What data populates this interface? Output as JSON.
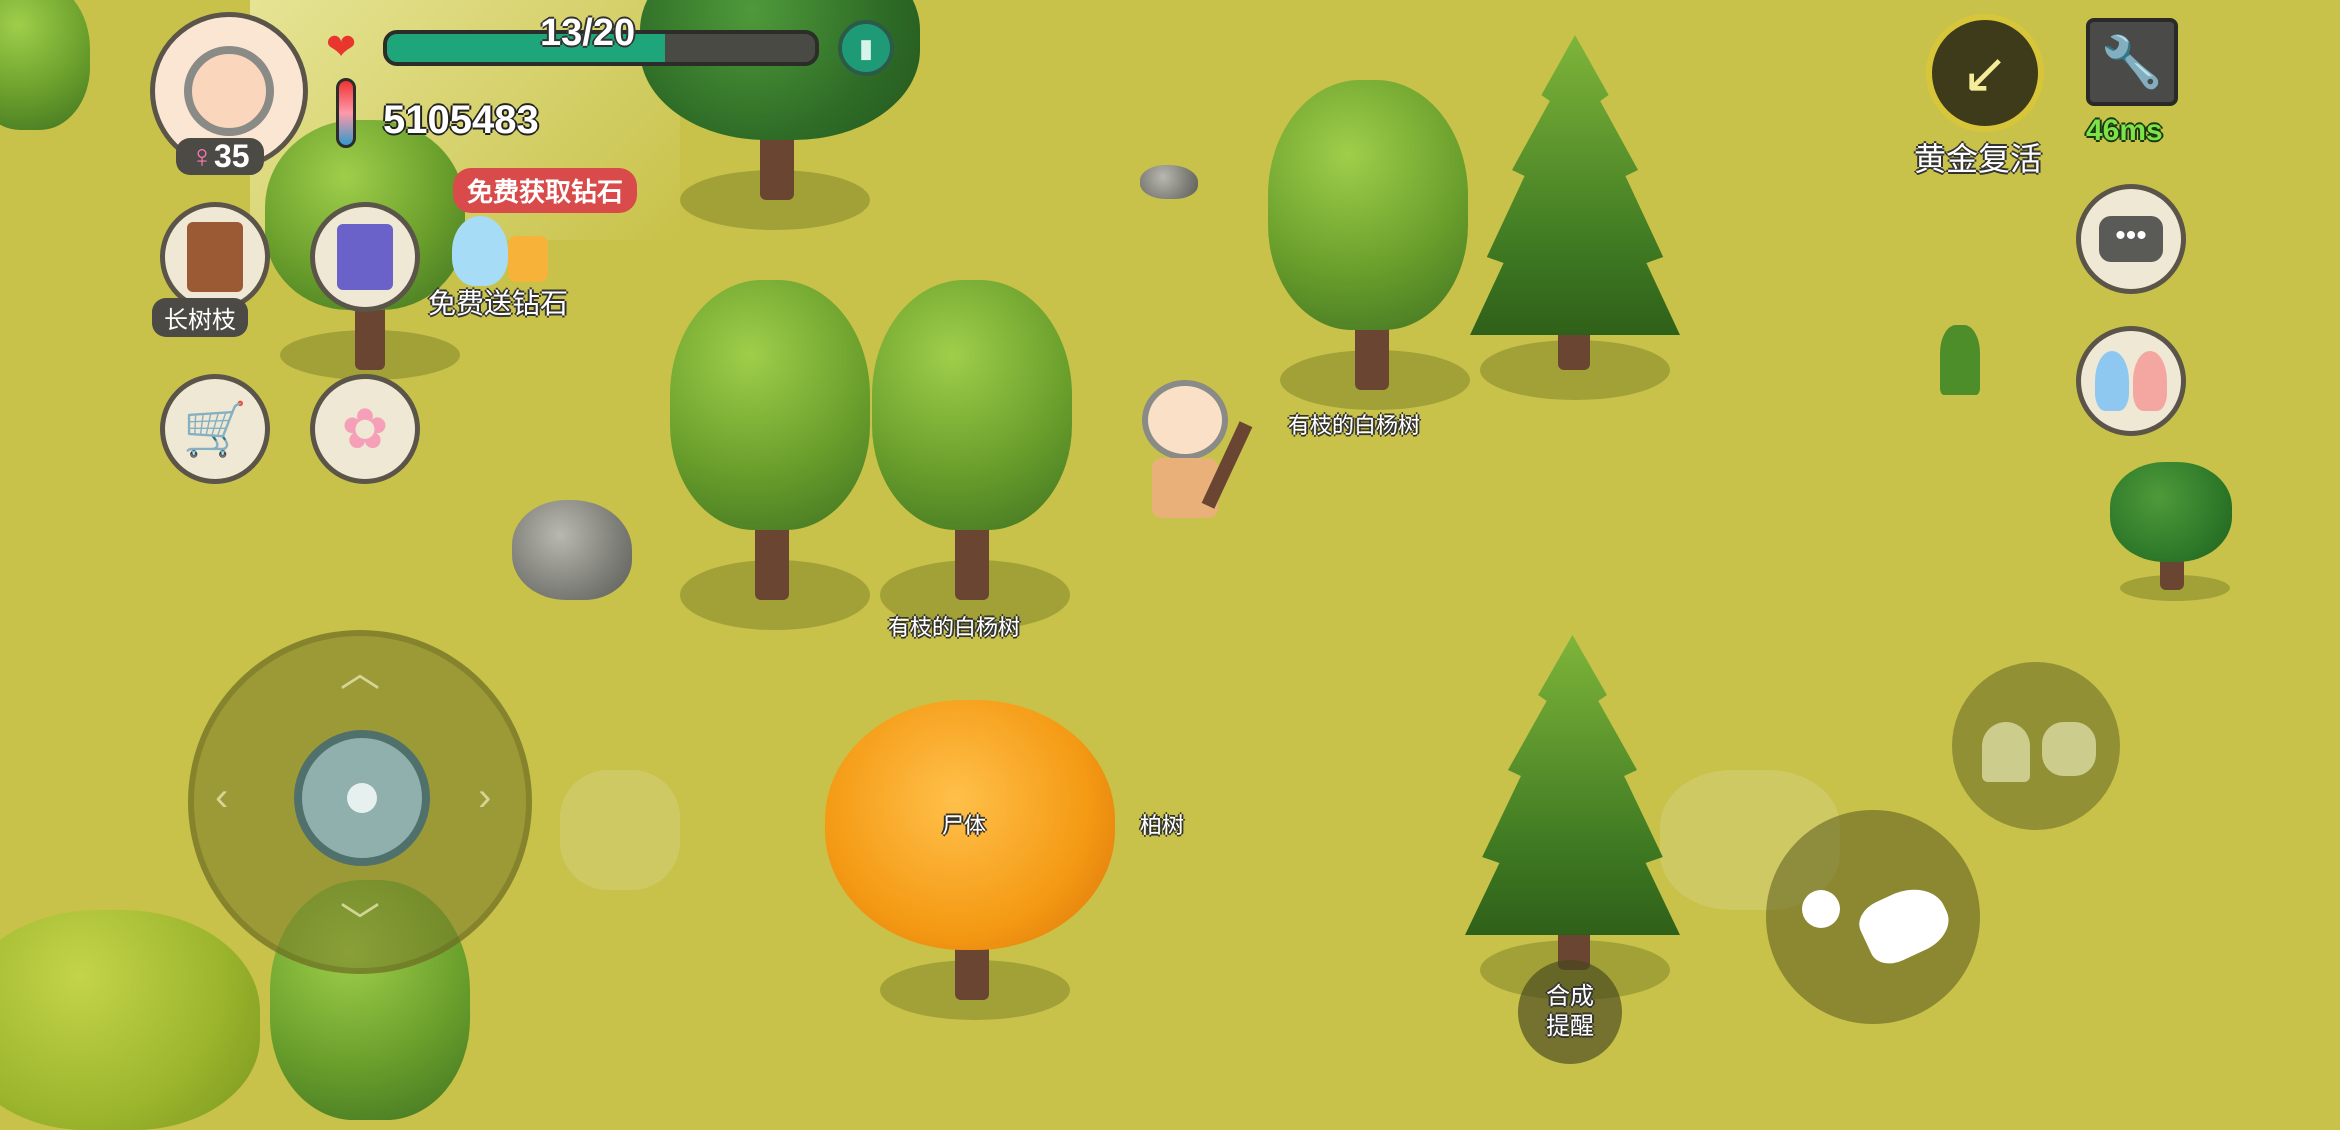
{
  "hud": {
    "level": "35",
    "health_text": "13/20",
    "health_fraction": 0.65,
    "coins": "5105483",
    "promo_badge": "免费获取钻石",
    "free_diamond_label": "免费送钻石",
    "held_item_label": "长树枝",
    "revive_label": "黄金复活",
    "ping": "46ms"
  },
  "world_labels": {
    "poplar_1": "有枝的白杨树",
    "poplar_2": "有枝的白杨树",
    "corpse": "尸体",
    "cypress": "柏树"
  },
  "controls": {
    "craft_hint_line1": "合成",
    "craft_hint_line2": "提醒"
  },
  "icons": {
    "heart": "heart-icon",
    "thermometer": "thermometer-icon",
    "backpack": "backpack-icon",
    "book": "book-icon",
    "cart": "shopping-cart-icon",
    "flower": "cherry-blossom-icon",
    "chat": "chat-bubble-icon",
    "friends": "friends-icon",
    "wrench": "wrench-icon",
    "revive": "arrow-revive-icon"
  },
  "colors": {
    "ground": "#c8c24a",
    "health_fill": "#1fa57a",
    "ping": "#7fe24a",
    "promo": "#d94a4a"
  }
}
